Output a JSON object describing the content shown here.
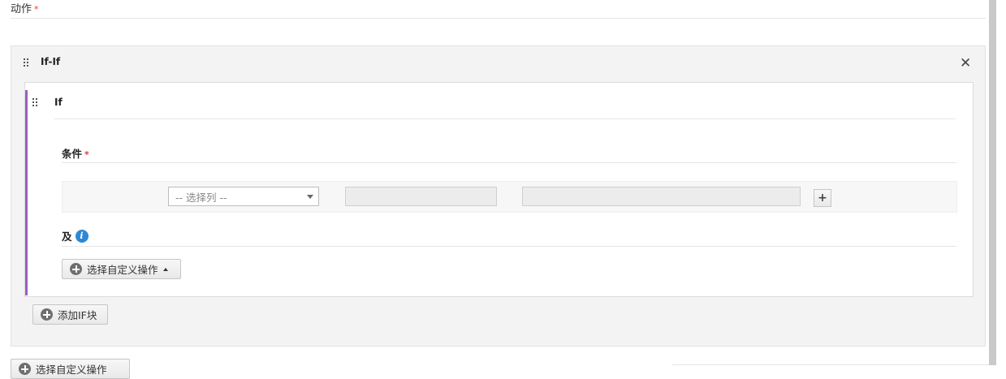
{
  "action_label": "动作",
  "required_mark": "*",
  "outer_block": {
    "title": "If-If",
    "close_symbol": "✕"
  },
  "if_block": {
    "title": "If",
    "condition_label": "条件",
    "column_select_placeholder": "-- 选择列 --",
    "add_condition_symbol": "+",
    "and_label": "及",
    "info_symbol": "i",
    "custom_action_button": "选择自定义操作",
    "accent_color": "#9b5fc0"
  },
  "add_if_block_button": "添加IF块",
  "bottom_button_partial": "选择自定义操作"
}
